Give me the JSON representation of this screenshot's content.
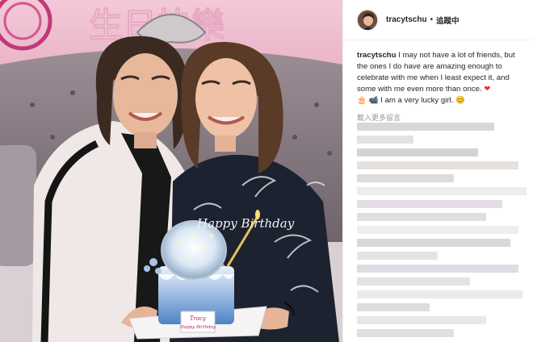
{
  "post": {
    "username": "tracytschu",
    "separator": "•",
    "follow_label": "追蹤中",
    "caption_user": "tracytschu",
    "caption_text": "I may not have a lot of friends, but the ones I do have are amazing enough to celebrate with me when I least expect it, and some with me even more than once.",
    "caption_emoji_heart": "❤",
    "caption_emoji_objects": "🎂 📹",
    "caption_tail": "I am a very lucky girl.",
    "caption_emoji_smile": "😊",
    "load_more_label": "載入更多留言"
  },
  "photo": {
    "cake_topper": "Happy Birthday",
    "cake_card_name": "Tracy",
    "cake_card_text": "Happy Birthday",
    "bg_sign_text": "生日快樂"
  },
  "colors": {
    "wall_pink": "#f4c6d6",
    "sofa_grey": "#8d7f86",
    "jacket_white": "#efe8e6",
    "dress_navy": "#1d2230",
    "cake_blue": "#6f9fd6",
    "heart_red": "#ed2e3a",
    "link_grey": "#999999"
  },
  "icons": [
    "profile-avatar",
    "heart-emoji",
    "cake-emoji",
    "camera-emoji",
    "smile-emoji"
  ]
}
